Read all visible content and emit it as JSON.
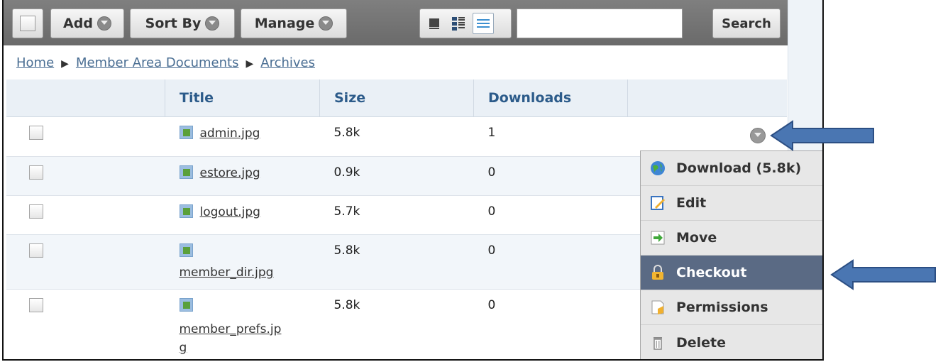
{
  "toolbar": {
    "add_label": "Add",
    "sort_label": "Sort By",
    "manage_label": "Manage",
    "search_label": "Search",
    "search_value": ""
  },
  "breadcrumb": {
    "items": [
      "Home",
      "Member Area Documents",
      "Archives"
    ]
  },
  "table": {
    "headers": [
      "",
      "Title",
      "Size",
      "Downloads",
      ""
    ],
    "rows": [
      {
        "title": "admin.jpg",
        "size": "5.8k",
        "downloads": "1"
      },
      {
        "title": "estore.jpg",
        "size": "0.9k",
        "downloads": "0"
      },
      {
        "title": "logout.jpg",
        "size": "5.7k",
        "downloads": "0"
      },
      {
        "title": "member_dir.jpg",
        "size": "5.8k",
        "downloads": "0"
      },
      {
        "title": "member_prefs.jpg",
        "size": "5.8k",
        "downloads": "0"
      }
    ]
  },
  "context_menu": {
    "items": [
      {
        "label": "Download (5.8k)",
        "icon": "globe-icon"
      },
      {
        "label": "Edit",
        "icon": "edit-icon"
      },
      {
        "label": "Move",
        "icon": "move-icon"
      },
      {
        "label": "Checkout",
        "icon": "lock-icon",
        "highlighted": true
      },
      {
        "label": "Permissions",
        "icon": "permissions-icon"
      },
      {
        "label": "Delete",
        "icon": "trash-icon"
      }
    ]
  },
  "colors": {
    "toolbar_bg": "#6a6a6a",
    "header_text": "#2c5b8a",
    "menu_highlight": "#5a6a84",
    "arrow": "#4a76b2"
  }
}
